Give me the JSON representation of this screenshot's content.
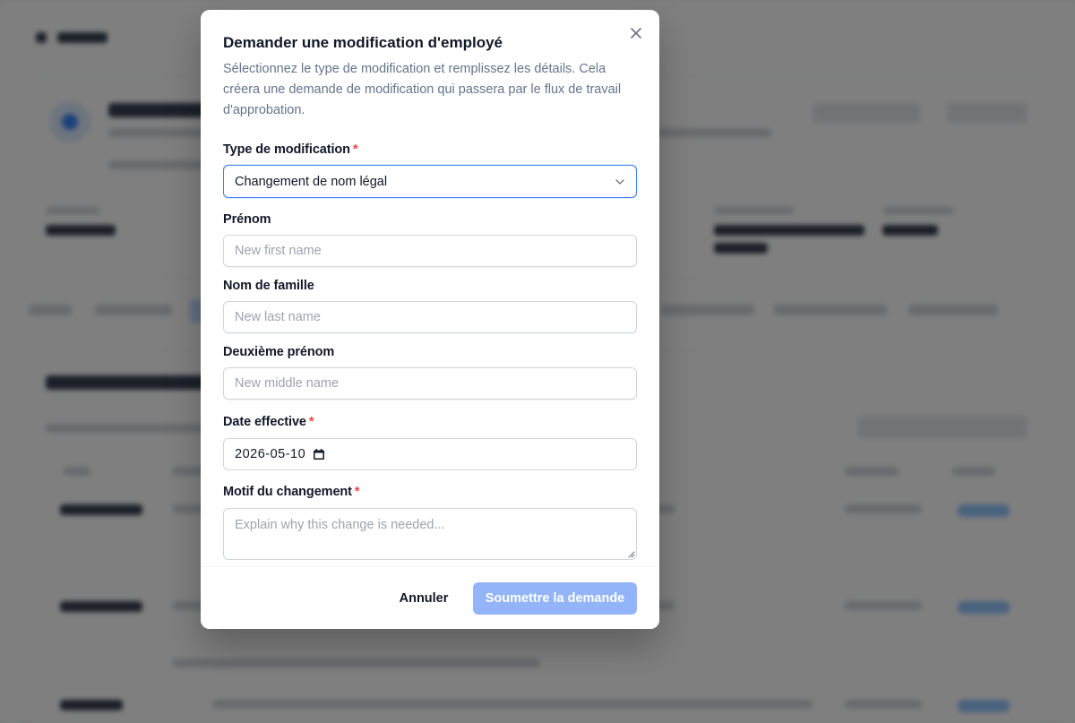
{
  "modal": {
    "title": "Demander une modification d'employé",
    "description": "Sélectionnez le type de modification et remplissez les détails. Cela créera une demande de modification qui passera par le flux de travail d'approbation.",
    "close_icon": "close-icon"
  },
  "fields": {
    "change_type": {
      "label": "Type de modification",
      "required_mark": "*",
      "value": "Changement de nom légal"
    },
    "first_name": {
      "label": "Prénom",
      "placeholder": "New first name"
    },
    "last_name": {
      "label": "Nom de famille",
      "placeholder": "New last name"
    },
    "middle_name": {
      "label": "Deuxième prénom",
      "placeholder": "New middle name"
    },
    "effective_date": {
      "label": "Date effective",
      "required_mark": "*",
      "value": "2026-05-10"
    },
    "reason": {
      "label": "Motif du changement",
      "required_mark": "*",
      "placeholder": "Explain why this change is needed..."
    }
  },
  "footer": {
    "cancel_label": "Annuler",
    "submit_label": "Soumettre la demande"
  },
  "colors": {
    "accent": "#3b82f6",
    "submit_disabled": "#93b4f8",
    "required": "#ef4444",
    "overlay": "rgba(0,0,0,0.5)"
  }
}
